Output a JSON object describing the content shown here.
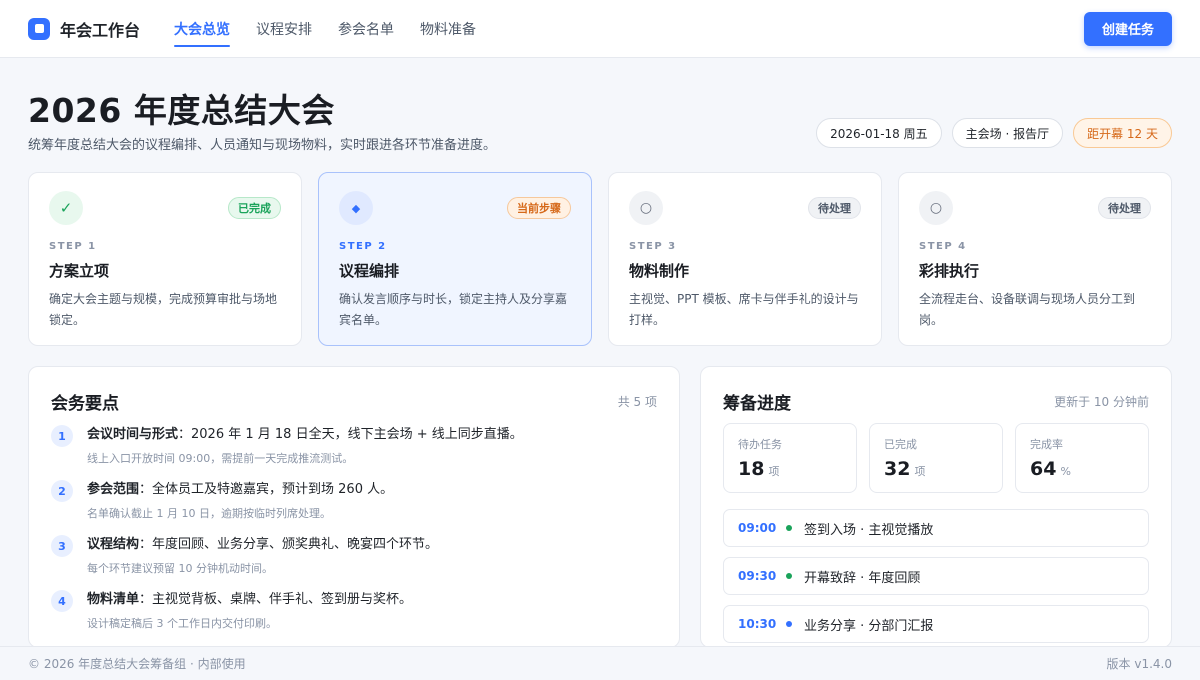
{
  "header": {
    "brand": "年会工作台",
    "nav": [
      {
        "label": "大会总览",
        "active": true
      },
      {
        "label": "议程安排",
        "active": false
      },
      {
        "label": "参会名单",
        "active": false
      },
      {
        "label": "物料准备",
        "active": false
      }
    ],
    "create_button": "创建任务"
  },
  "page": {
    "title": "2026 年度总结大会",
    "description": "统筹年度总结大会的议程编排、人员通知与现场物料，实时跟进各环节准备进度。",
    "chips": [
      "2026-01-18 周五",
      "主会场 · 报告厅",
      "距开幕 12 天"
    ]
  },
  "steps": [
    {
      "no": "STEP 1",
      "title": "方案立项",
      "desc": "确定大会主题与规模，完成预算审批与场地锁定。",
      "badge": "已完成",
      "icon": "check-icon",
      "glyph": "✓"
    },
    {
      "no": "STEP 2",
      "title": "议程编排",
      "desc": "确认发言顺序与时长，锁定主持人及分享嘉宾名单。",
      "badge": "当前步骤",
      "icon": "diamond-icon",
      "glyph": "◆"
    },
    {
      "no": "STEP 3",
      "title": "物料制作",
      "desc": "主视觉、PPT 模板、席卡与伴手礼的设计与打样。",
      "badge": "待处理",
      "icon": "circle-icon",
      "glyph": "○"
    },
    {
      "no": "STEP 4",
      "title": "彩排执行",
      "desc": "全流程走台、设备联调与现场人员分工到岗。",
      "badge": "待处理",
      "icon": "circle-icon",
      "glyph": "○"
    }
  ],
  "points_panel": {
    "title": "会务要点",
    "count": "共 5 项",
    "items": [
      {
        "num": "1",
        "label": "会议时间与形式",
        "text": "：2026 年 1 月 18 日全天，线下主会场 + 线上同步直播。",
        "sub": "线上入口开放时间 09:00，需提前一天完成推流测试。"
      },
      {
        "num": "2",
        "label": "参会范围",
        "text": "：全体员工及特邀嘉宾，预计到场 260 人。",
        "sub": "名单确认截止 1 月 10 日，逾期按临时列席处理。"
      },
      {
        "num": "3",
        "label": "议程结构",
        "text": "：年度回顾、业务分享、颁奖典礼、晚宴四个环节。",
        "sub": "每个环节建议预留 10 分钟机动时间。"
      },
      {
        "num": "4",
        "label": "物料清单",
        "text": "：主视觉背板、桌牌、伴手礼、签到册与奖杯。",
        "sub": "设计稿定稿后 3 个工作日内交付印刷。"
      }
    ]
  },
  "progress_panel": {
    "title": "筹备进度",
    "updated": "更新于 10 分钟前",
    "stats": [
      {
        "label": "待办任务",
        "value": "18",
        "unit": "项"
      },
      {
        "label": "已完成",
        "value": "32",
        "unit": "项"
      },
      {
        "label": "完成率",
        "value": "64",
        "unit": "%"
      }
    ],
    "schedule": [
      {
        "time": "09:00",
        "text": "签到入场 · 主视觉播放",
        "color": "#1aa35a"
      },
      {
        "time": "09:30",
        "text": "开幕致辞 · 年度回顾",
        "color": "#1aa35a"
      },
      {
        "time": "10:30",
        "text": "业务分享 · 分部门汇报",
        "color": "#3370ff"
      }
    ]
  },
  "footer": {
    "copyright": "© 2026 年度总结大会筹备组 · 内部使用",
    "version": "版本 v1.4.0"
  },
  "colors": {
    "accent": "#3370ff",
    "success": "#1aa35a",
    "warning": "#d6691a"
  }
}
